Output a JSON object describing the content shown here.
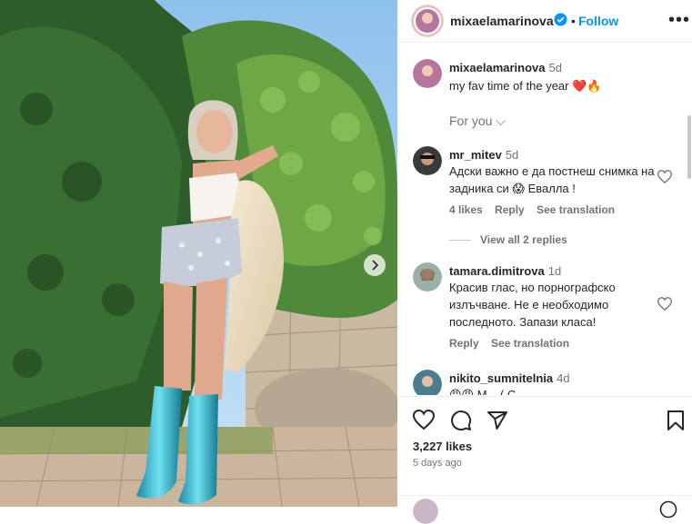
{
  "post": {
    "author": "mixaelamarinova",
    "follow_label": "Follow",
    "separator": "•",
    "more_label": "•••",
    "caption": {
      "user": "mixaelamarinova",
      "time": "5d",
      "text": "my fav time of the year ❤️🔥"
    },
    "for_you_label": "For you ⌵",
    "likes": "3,227 likes",
    "posted_ago": "5 days ago"
  },
  "comments": [
    {
      "user": "mr_mitev",
      "time": "5d",
      "text": "Адски важно е да постнеш снимка на задника си 😱 Евалла !",
      "likes": "4 likes",
      "reply_label": "Reply",
      "translate_label": "See translation"
    },
    {
      "user": "tamara.dimitrova",
      "time": "1d",
      "text": "Красив глас, но порнографско излъчване. Не е необходимо последното. Запази класа!",
      "reply_label": "Reply",
      "translate_label": "See translation"
    },
    {
      "user": "nikito_sumnitelnia",
      "time": "4d",
      "text": "😡😡 М... ( С... "
    }
  ],
  "view_replies_label": "View all 2 replies",
  "colors": {
    "accent": "#0095f6",
    "heart": "#ed4956",
    "muted": "#737373",
    "verified": "#0095f6"
  },
  "icons": [
    "heart-icon",
    "comment-icon",
    "share-icon",
    "bookmark-icon",
    "verified-badge-icon",
    "chevron-right-icon"
  ]
}
